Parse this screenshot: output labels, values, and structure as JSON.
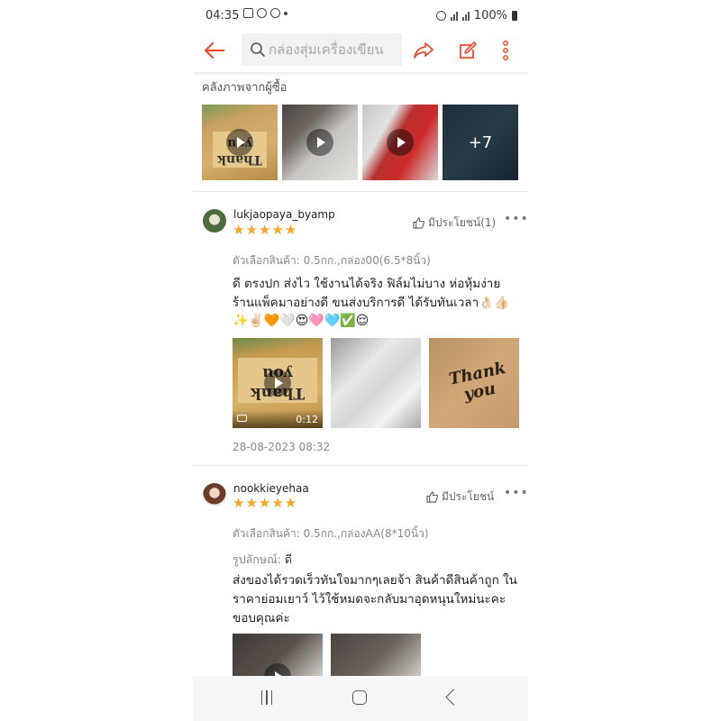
{
  "status_bar": {
    "time": "04:35",
    "battery": "100%"
  },
  "header": {
    "search_placeholder": "กล่องสุ่มเครื่องเขียน"
  },
  "buyer_gallery": {
    "title": "คลังภาพจากผู้ซื้อ",
    "more_count": "+7"
  },
  "reviews": [
    {
      "username": "lukjaopaya_byamp",
      "stars": "★★★★★",
      "helpful_label": "มีประโยชน์(1)",
      "variant": "ตัวเลือกสินค้า: 0.5กก.,กล่อง00(6.5*8นิ้ว)",
      "text": "ดี ตรงปก ส่งไว ใช้งานได้จริง ฟิล์มไม่บาง ห่อหุ้มง่าย ร้านแพ็คมาอย่างดี ขนส่งบริการดี ได้รับทันเวลา👌🏻👍🏻",
      "emojis": "✨✌🏻🧡🤍😍🩷🩵✅😌",
      "video_duration": "0:12",
      "date": "28-08-2023 08:32"
    },
    {
      "username": "nookkieyehaa",
      "stars": "★★★★★",
      "helpful_label": "มีประโยชน์",
      "variant": "ตัวเลือกสินค้า: 0.5กก.,กล่องAA(8*10นิ้ว)",
      "appearance_label": "รูปลักษณ์:",
      "appearance_value": "ดี",
      "text": "ส่งของได้รวดเร็วทันใจมากๆเลยจ้า สินค้าดีสินค้าถูก ในราคาย่อมเยาว์ ไว้ใช้หมดจะกลับมาอุดหนุนใหม่นะคะ ขอบคุณค่ะ"
    }
  ],
  "icons": {
    "accent": "#ee4d2d",
    "star": "#f5a623"
  }
}
